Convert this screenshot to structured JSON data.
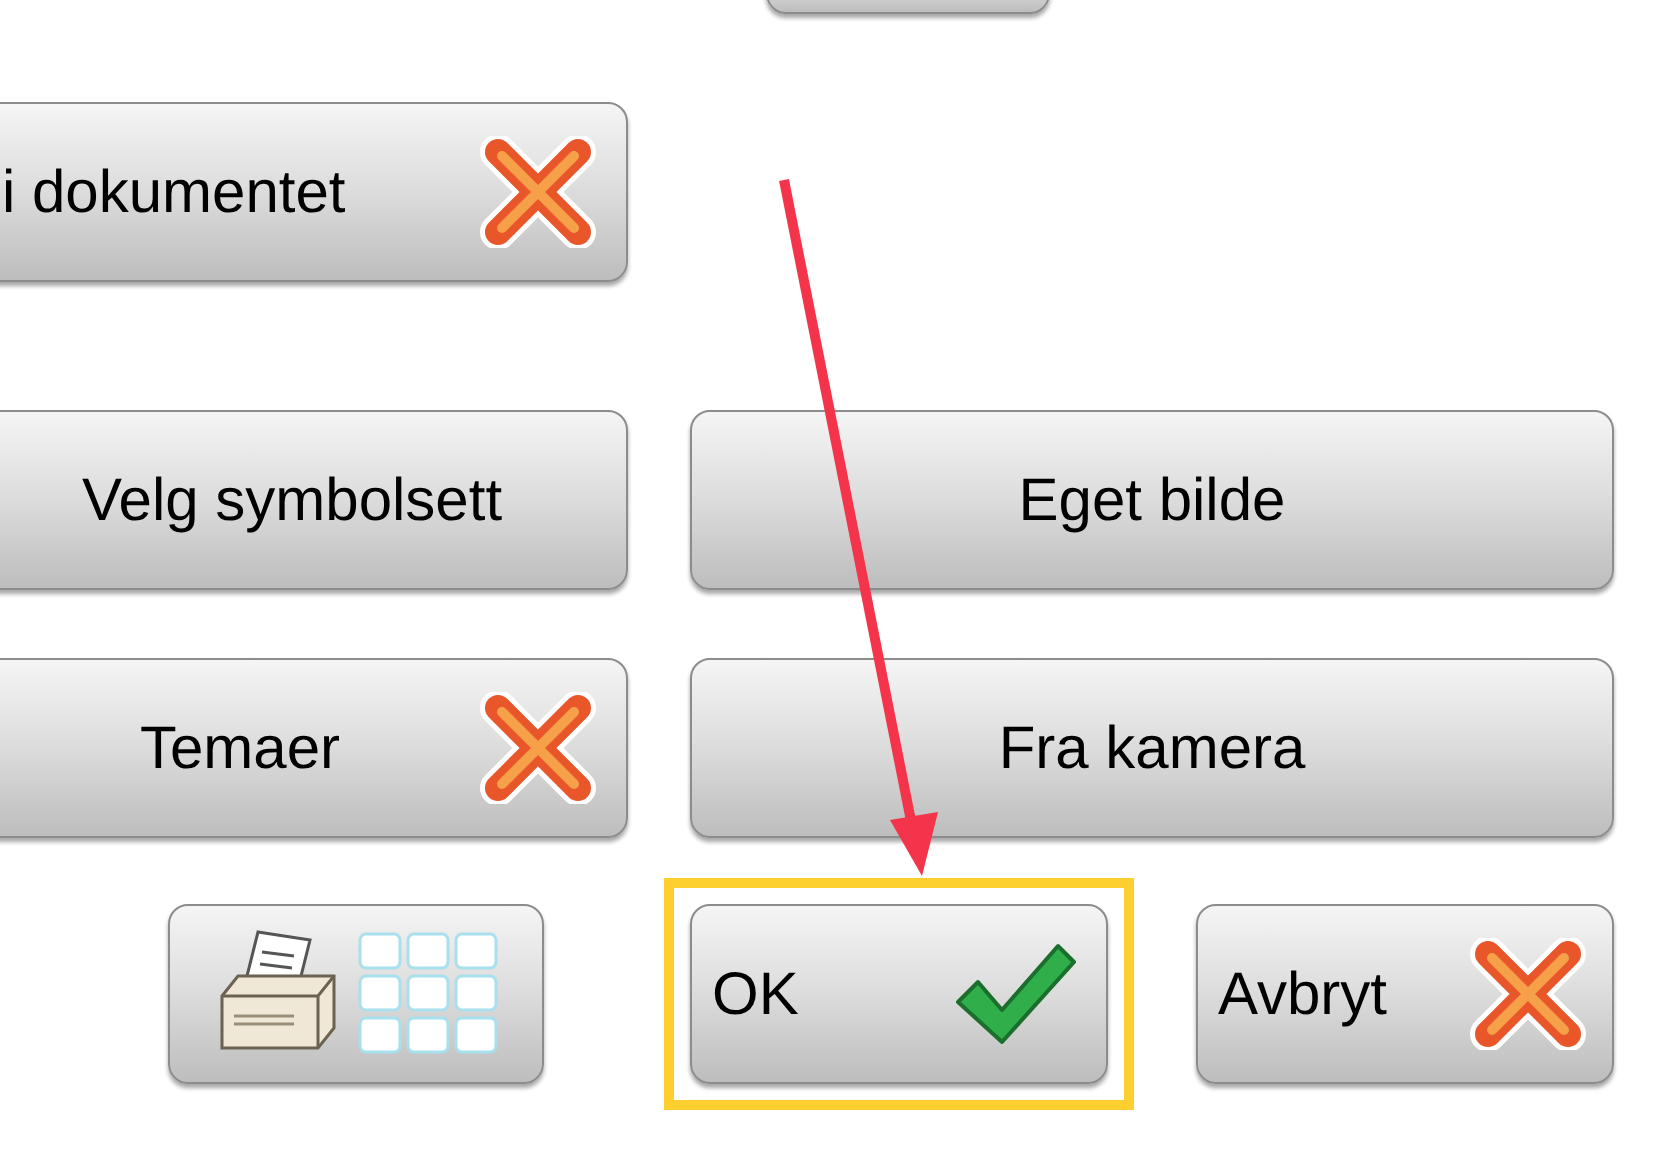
{
  "rows": [
    {
      "buttons": [
        {
          "label": "i dokumentet",
          "kind": "remove"
        }
      ]
    },
    {
      "buttons": [
        {
          "label": "Velg symbolsett",
          "kind": "plain"
        },
        {
          "label": "Eget bilde",
          "kind": "plain"
        }
      ]
    },
    {
      "buttons": [
        {
          "label": "Temaer",
          "kind": "remove"
        },
        {
          "label": "Fra kamera",
          "kind": "plain"
        }
      ]
    }
  ],
  "bottom_buttons": [
    {
      "kind": "print",
      "highlighted": false
    },
    {
      "kind": "confirm",
      "label": "OK",
      "highlighted": true
    },
    {
      "kind": "cancel",
      "label": "Avbryt",
      "highlighted": false
    }
  ]
}
